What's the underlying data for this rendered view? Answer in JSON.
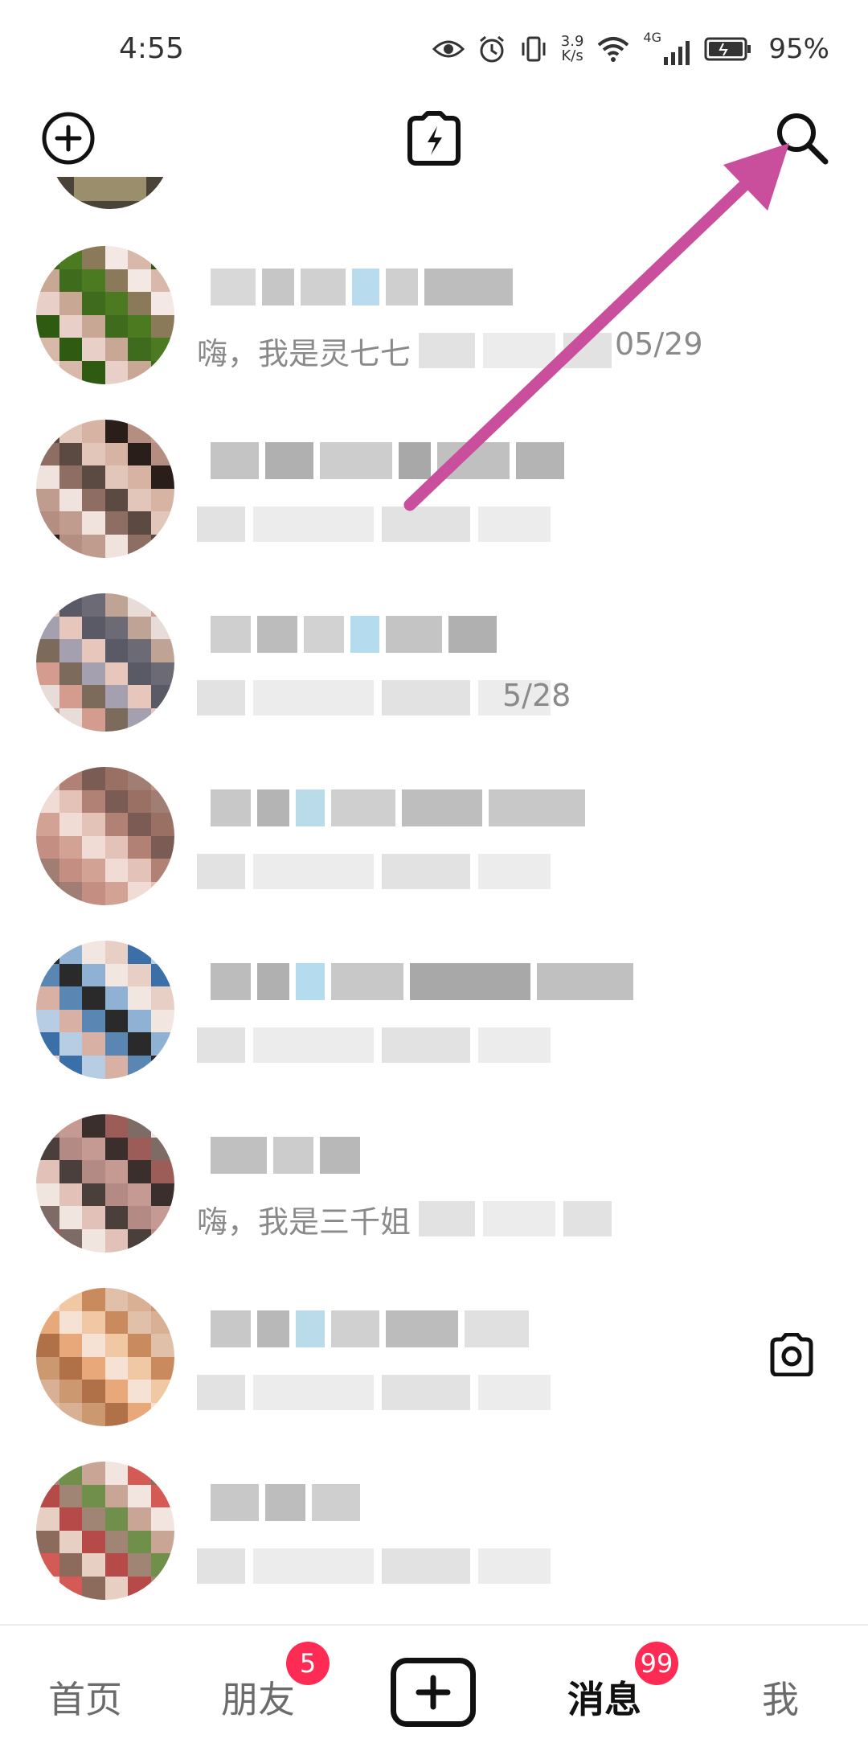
{
  "status_bar": {
    "time": "4:55",
    "net_speed_value": "3.9",
    "net_speed_unit": "K/s",
    "network": "4G",
    "battery": "95%"
  },
  "top_bar": {
    "add_icon": "plus-circle-icon",
    "center_icon": "lightning-camera-icon",
    "search_icon": "search-icon"
  },
  "chats": [
    {
      "preview_text": "嗨，我是灵七七",
      "date": "05/29"
    },
    {
      "preview_text": "",
      "date": ""
    },
    {
      "preview_text": "",
      "date": "5/28"
    },
    {
      "preview_text": "",
      "date": ""
    },
    {
      "preview_text": "",
      "date": ""
    },
    {
      "preview_text": "嗨，我是三千姐",
      "date": ""
    },
    {
      "preview_text": "",
      "date": ""
    },
    {
      "preview_text": "",
      "date": ""
    }
  ],
  "bottom_nav": {
    "home": "首页",
    "friends": "朋友",
    "friends_badge": "5",
    "messages": "消息",
    "messages_badge": "99",
    "me": "我"
  },
  "colors": {
    "accent": "#fe2c55",
    "annotation_arrow": "#c94f9c"
  }
}
